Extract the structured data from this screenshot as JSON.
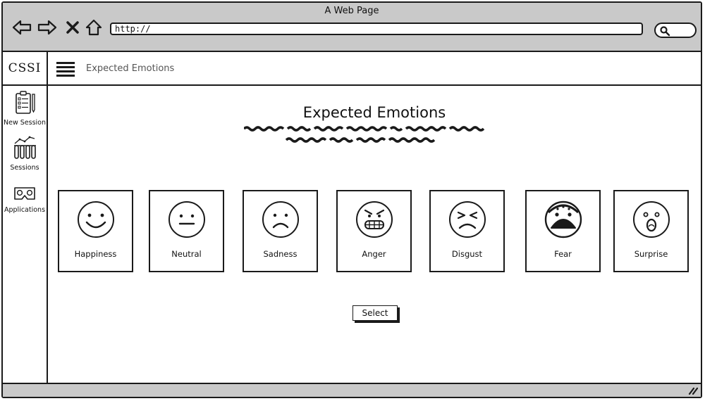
{
  "window": {
    "title": "A Web Page"
  },
  "browser": {
    "url_value": "http://",
    "nav_icons": [
      "back-arrow-icon",
      "forward-arrow-icon",
      "close-x-icon",
      "home-icon"
    ],
    "search_icon": "search-icon"
  },
  "sidebar": {
    "brand": "CSSI",
    "items": [
      {
        "label": "New Session",
        "icon": "clipboard-checklist-icon"
      },
      {
        "label": "Sessions",
        "icon": "test-tubes-chart-icon"
      },
      {
        "label": "Applications",
        "icon": "vr-headset-icon"
      }
    ]
  },
  "topbar": {
    "title": "Expected Emotions",
    "menu_icon": "hamburger-menu-icon"
  },
  "main": {
    "title": "Expected Emotions",
    "emotions": [
      {
        "label": "Happiness",
        "icon": "happy-face-icon"
      },
      {
        "label": "Neutral",
        "icon": "neutral-face-icon"
      },
      {
        "label": "Sadness",
        "icon": "sad-face-icon"
      },
      {
        "label": "Anger",
        "icon": "angry-face-icon"
      },
      {
        "label": "Disgust",
        "icon": "disgusted-face-icon"
      },
      {
        "label": "Fear",
        "icon": "fearful-face-icon"
      },
      {
        "label": "Surprise",
        "icon": "surprised-face-icon"
      }
    ],
    "select_label": "Select"
  },
  "colors": {
    "chrome": "#c9c9c9",
    "ink": "#1a1a1a",
    "background": "#ffffff"
  }
}
